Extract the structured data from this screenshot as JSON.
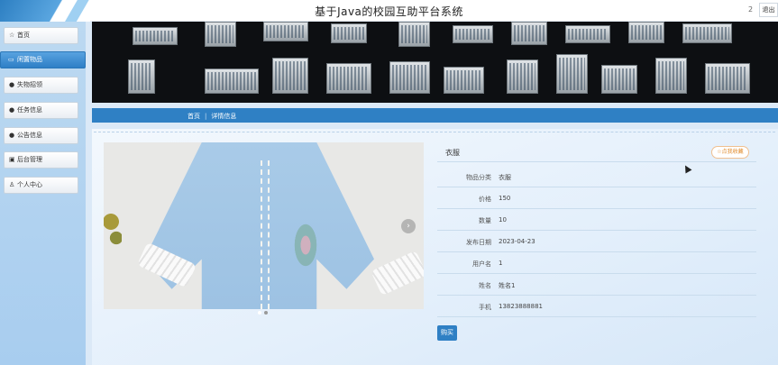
{
  "header": {
    "title": "基于Java的校园互助平台系统",
    "user_count": "2",
    "logout_label": "退出"
  },
  "sidebar": {
    "items": [
      {
        "label": "首页",
        "icon": "star-icon"
      },
      {
        "label": "闲置物品",
        "icon": "box-icon",
        "active": true
      },
      {
        "label": "失物招领",
        "icon": "info-icon"
      },
      {
        "label": "任务信息",
        "icon": "question-icon"
      },
      {
        "label": "公告信息",
        "icon": "info-icon"
      },
      {
        "label": "后台管理",
        "icon": "monitor-icon"
      },
      {
        "label": "个人中心",
        "icon": "user-icon"
      }
    ]
  },
  "breadcrumb": {
    "home": "首页",
    "separator": "|",
    "current": "详情信息"
  },
  "detail": {
    "title": "衣服",
    "favorite_label": "☆点我收藏",
    "fields": [
      {
        "key": "物品分类",
        "value": "衣服"
      },
      {
        "key": "价格",
        "value": "150"
      },
      {
        "key": "数量",
        "value": "10"
      },
      {
        "key": "发布日期",
        "value": "2023-04-23"
      },
      {
        "key": "用户名",
        "value": "1"
      },
      {
        "key": "姓名",
        "value": "姓名1"
      },
      {
        "key": "手机",
        "value": "13823888881"
      }
    ],
    "buy_label": "购买"
  },
  "carousel": {
    "next_glyph": "›"
  },
  "colors": {
    "primary": "#2f80c4",
    "accent": "#e08a2a"
  }
}
